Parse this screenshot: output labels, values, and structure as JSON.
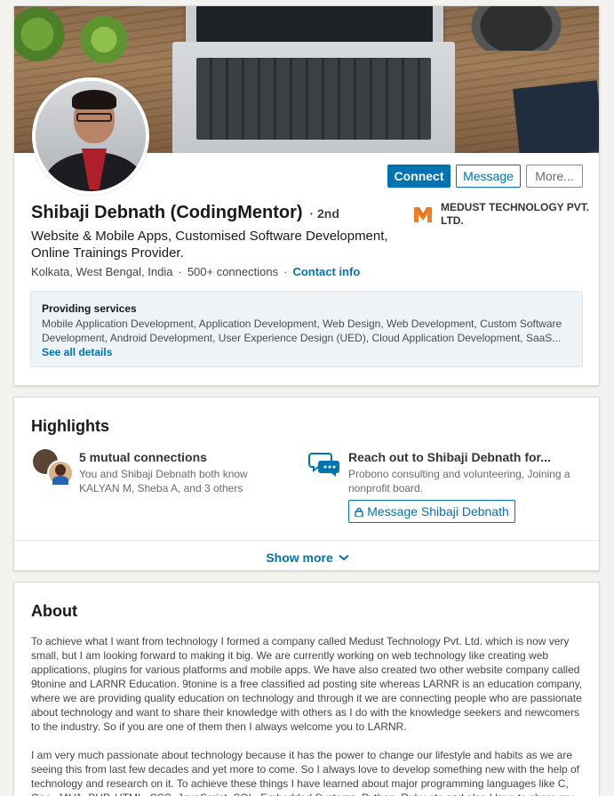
{
  "profile": {
    "name": "Shibaji Debnath (CodingMentor)",
    "degree_separator": "·",
    "degree": "2nd",
    "headline": "Website & Mobile Apps, Customised Software Development, Online Trainings Provider.",
    "location": "Kolkata, West Bengal, India",
    "dot": "·",
    "connections": "500+ connections",
    "contact_info": "Contact info",
    "company": {
      "name": "MEDUST TECHNOLOGY PVT. LTD.",
      "logo_letter": "M",
      "logo_color": "#f47b20"
    }
  },
  "actions": {
    "connect": "Connect",
    "message": "Message",
    "more": "More..."
  },
  "services": {
    "title": "Providing services",
    "list": "Mobile Application Development, Application Development, Web Design, Web Development, Custom Software Development, Android Development, User Experience Design (UED), Cloud Application Development, SaaS...",
    "see_all": "See all details"
  },
  "highlights": {
    "title": "Highlights",
    "mutual": {
      "title": "5 mutual connections",
      "subtitle": "You and Shibaji Debnath both know KALYAN M, Sheba A, and 3 others"
    },
    "reach_out": {
      "title": "Reach out to Shibaji Debnath for...",
      "subtitle": "Probono consulting and volunteering, Joining a nonprofit board.",
      "button": "Message Shibaji Debnath"
    },
    "show_more": "Show more"
  },
  "about": {
    "title": "About",
    "paragraph_1": "To achieve what I want from technology I formed a company called Medust Technology Pvt. Ltd. which is now very small, but I am looking forward to making it big. We are currently working on web technology like creating web applications, plugins for various platforms and mobile apps. We have also created two other website company called 9tonine and LARNR Education. 9tonine is a free classified ad posting site whereas LARNR is an education company, where we are providing quality education on technology and through it we are connecting people who are passionate about technology and want to share their knowledge with others as I do with the knowledge seekers and newcomers to the industry. So if you are one of them then I always welcome you to LARNR.",
    "paragraph_2": "I am very much passionate about technology because it has the power to change our lifestyle and habits as we are seeing this from last few decades and yet more to come. So I always love to develop something new with the help of technology and research on it. To achieve these things I have learned about major programming languages like C, C++, JAVA, PHP, HTML, CSS, JavaScript, SQL, Embedded Systems, Python, Ruby etc and also I love to share my knowledge"
  },
  "colors": {
    "accent": "#0073b1",
    "background": "#f3f2ef",
    "card": "#ffffff",
    "services_box": "#eef3f8"
  },
  "icons": {
    "company_logo": "medust-logo-icon",
    "chat": "chat-bubbles-icon",
    "lock": "lock-icon",
    "chevron": "chevron-down-icon"
  }
}
